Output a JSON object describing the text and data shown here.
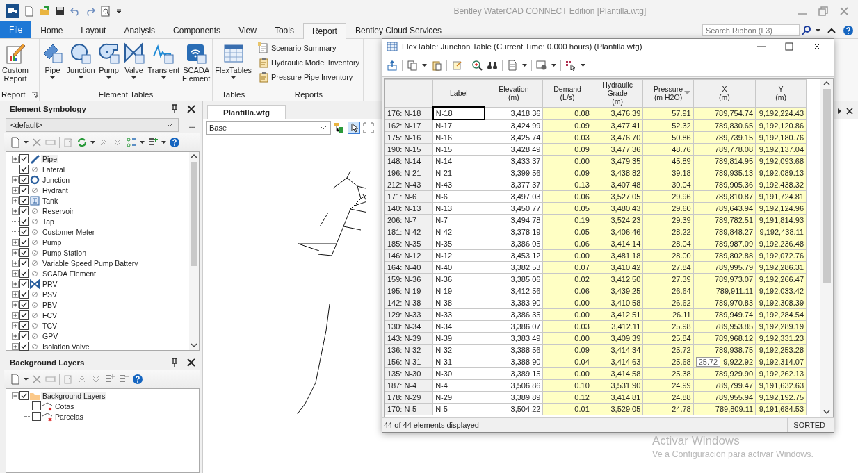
{
  "window": {
    "title": "Bentley WaterCAD CONNECT Edition [Plantilla.wtg]"
  },
  "ribbon": {
    "tabs": [
      {
        "label": "File",
        "kind": "file",
        "selected": false
      },
      {
        "label": "Home",
        "kind": "tab",
        "selected": false
      },
      {
        "label": "Layout",
        "kind": "tab",
        "selected": false
      },
      {
        "label": "Analysis",
        "kind": "tab",
        "selected": false
      },
      {
        "label": "Components",
        "kind": "tab",
        "selected": false
      },
      {
        "label": "View",
        "kind": "tab",
        "selected": false
      },
      {
        "label": "Tools",
        "kind": "tab",
        "selected": false
      },
      {
        "label": "Report",
        "kind": "tab",
        "selected": true
      },
      {
        "label": "Bentley Cloud Services",
        "kind": "tab",
        "selected": false
      }
    ],
    "search": {
      "placeholder": "Search Ribbon (F3)"
    },
    "groups": [
      {
        "label": "Report",
        "kind": "large",
        "launcher": true,
        "items": [
          {
            "label": "Custom\nReport",
            "kind": "report",
            "dropdown": false
          }
        ]
      },
      {
        "label": "Element Tables",
        "kind": "large",
        "launcher": false,
        "items": [
          {
            "label": "Pipe",
            "kind": "pipe",
            "dropdown": true
          },
          {
            "label": "Junction",
            "kind": "junction",
            "dropdown": true
          },
          {
            "label": "Pump",
            "kind": "pump",
            "dropdown": true
          },
          {
            "label": "Valve",
            "kind": "valve",
            "dropdown": true
          },
          {
            "label": "Transient",
            "kind": "transient",
            "dropdown": true
          },
          {
            "label": "SCADA\nElement",
            "kind": "scada",
            "dropdown": false
          }
        ]
      },
      {
        "label": "Tables",
        "kind": "large",
        "launcher": false,
        "items": [
          {
            "label": "FlexTables",
            "kind": "flextables",
            "dropdown": true
          }
        ]
      },
      {
        "label": "Reports",
        "kind": "list",
        "launcher": false,
        "items": [
          {
            "label": "Scenario Summary",
            "kind": "document"
          },
          {
            "label": "Hydraulic Model Inventory",
            "kind": "clipboard"
          },
          {
            "label": "Pressure Pipe Inventory",
            "kind": "clipboard"
          }
        ]
      }
    ]
  },
  "symbology": {
    "title": "Element Symbology",
    "profile": "<default>",
    "more": "...",
    "items": [
      {
        "label": "Pipe",
        "kind": "pipe",
        "checked": true,
        "expandable": true,
        "selected": true
      },
      {
        "label": "Lateral",
        "kind": "none",
        "checked": true,
        "expandable": false,
        "selected": false
      },
      {
        "label": "Junction",
        "kind": "junction",
        "checked": true,
        "expandable": true,
        "selected": false
      },
      {
        "label": "Hydrant",
        "kind": "none",
        "checked": true,
        "expandable": true,
        "selected": false
      },
      {
        "label": "Tank",
        "kind": "tank",
        "checked": true,
        "expandable": true,
        "selected": false
      },
      {
        "label": "Reservoir",
        "kind": "none",
        "checked": true,
        "expandable": true,
        "selected": false
      },
      {
        "label": "Tap",
        "kind": "none",
        "checked": true,
        "expandable": false,
        "selected": false
      },
      {
        "label": "Customer Meter",
        "kind": "none",
        "checked": true,
        "expandable": false,
        "selected": false
      },
      {
        "label": "Pump",
        "kind": "none",
        "checked": true,
        "expandable": true,
        "selected": false
      },
      {
        "label": "Pump Station",
        "kind": "none",
        "checked": true,
        "expandable": true,
        "selected": false
      },
      {
        "label": "Variable Speed Pump Battery",
        "kind": "none",
        "checked": true,
        "expandable": true,
        "selected": false
      },
      {
        "label": "SCADA Element",
        "kind": "none",
        "checked": true,
        "expandable": true,
        "selected": false
      },
      {
        "label": "PRV",
        "kind": "prv",
        "checked": true,
        "expandable": true,
        "selected": false
      },
      {
        "label": "PSV",
        "kind": "none",
        "checked": true,
        "expandable": true,
        "selected": false
      },
      {
        "label": "PBV",
        "kind": "none",
        "checked": true,
        "expandable": true,
        "selected": false
      },
      {
        "label": "FCV",
        "kind": "none",
        "checked": true,
        "expandable": true,
        "selected": false
      },
      {
        "label": "TCV",
        "kind": "none",
        "checked": true,
        "expandable": true,
        "selected": false
      },
      {
        "label": "GPV",
        "kind": "none",
        "checked": true,
        "expandable": true,
        "selected": false
      },
      {
        "label": "Isolation Valve",
        "kind": "none",
        "checked": true,
        "expandable": true,
        "selected": false
      }
    ]
  },
  "background_layers": {
    "title": "Background Layers",
    "items": [
      {
        "label": "Background Layers",
        "kind": "folder",
        "checked": true,
        "expanded": true,
        "selected": true,
        "children": [
          {
            "label": "Cotas",
            "kind": "layer",
            "checked": false,
            "selected": false
          },
          {
            "label": "Parcelas",
            "kind": "layer",
            "checked": false,
            "selected": false
          }
        ]
      }
    ]
  },
  "drawing": {
    "tab": "Plantilla.wtg",
    "scenario": "Base"
  },
  "flextable": {
    "title": "FlexTable: Junction Table (Current Time:  0.000 hours) (Plantilla.wtg)",
    "columns": [
      {
        "label": "Label",
        "read_only": false,
        "sorted": false
      },
      {
        "label": "Elevation\n(m)",
        "read_only": false,
        "sorted": false
      },
      {
        "label": "Demand\n(L/s)",
        "read_only": true,
        "sorted": false
      },
      {
        "label": "Hydraulic\nGrade\n(m)",
        "read_only": true,
        "sorted": false
      },
      {
        "label": "Pressure\n(m H2O)",
        "read_only": true,
        "sorted": true
      },
      {
        "label": "X\n(m)",
        "read_only": true,
        "sorted": false
      },
      {
        "label": "Y\n(m)",
        "read_only": true,
        "sorted": false
      }
    ],
    "rows": [
      {
        "id": "176: N-18",
        "focused": true,
        "cells": [
          "N-18",
          "3,418.36",
          "0.08",
          "3,476.39",
          "57.91",
          "789,754.74",
          "9,192,224.43"
        ]
      },
      {
        "id": "162: N-17",
        "focused": false,
        "cells": [
          "N-17",
          "3,424.99",
          "0.09",
          "3,477.41",
          "52.32",
          "789,830.65",
          "9,192,120.86"
        ]
      },
      {
        "id": "175: N-16",
        "focused": false,
        "cells": [
          "N-16",
          "3,425.74",
          "0.03",
          "3,476.70",
          "50.86",
          "789,739.15",
          "9,192,180.76"
        ]
      },
      {
        "id": "190: N-15",
        "focused": false,
        "cells": [
          "N-15",
          "3,428.49",
          "0.09",
          "3,477.36",
          "48.76",
          "789,778.08",
          "9,192,137.04"
        ]
      },
      {
        "id": "148: N-14",
        "focused": false,
        "cells": [
          "N-14",
          "3,433.37",
          "0.00",
          "3,479.35",
          "45.89",
          "789,814.95",
          "9,192,093.68"
        ]
      },
      {
        "id": "196: N-21",
        "focused": false,
        "cells": [
          "N-21",
          "3,399.56",
          "0.09",
          "3,438.82",
          "39.18",
          "789,935.13",
          "9,192,089.13"
        ]
      },
      {
        "id": "212: N-43",
        "focused": false,
        "cells": [
          "N-43",
          "3,377.37",
          "0.13",
          "3,407.48",
          "30.04",
          "789,905.36",
          "9,192,438.32"
        ]
      },
      {
        "id": "171: N-6",
        "focused": false,
        "cells": [
          "N-6",
          "3,497.03",
          "0.06",
          "3,527.05",
          "29.96",
          "789,810.87",
          "9,191,724.81"
        ]
      },
      {
        "id": "140: N-13",
        "focused": false,
        "cells": [
          "N-13",
          "3,450.77",
          "0.05",
          "3,480.43",
          "29.60",
          "789,643.94",
          "9,192,124.96"
        ]
      },
      {
        "id": "206: N-7",
        "focused": false,
        "cells": [
          "N-7",
          "3,494.78",
          "0.19",
          "3,524.23",
          "29.39",
          "789,782.51",
          "9,191,814.93"
        ]
      },
      {
        "id": "181: N-42",
        "focused": false,
        "cells": [
          "N-42",
          "3,378.19",
          "0.05",
          "3,406.46",
          "28.22",
          "789,848.27",
          "9,192,438.11"
        ]
      },
      {
        "id": "185: N-35",
        "focused": false,
        "cells": [
          "N-35",
          "3,386.05",
          "0.06",
          "3,414.14",
          "28.04",
          "789,987.09",
          "9,192,236.48"
        ]
      },
      {
        "id": "146: N-12",
        "focused": false,
        "cells": [
          "N-12",
          "3,453.12",
          "0.00",
          "3,481.18",
          "28.00",
          "789,802.88",
          "9,192,072.76"
        ]
      },
      {
        "id": "164: N-40",
        "focused": false,
        "cells": [
          "N-40",
          "3,382.53",
          "0.07",
          "3,410.42",
          "27.84",
          "789,995.79",
          "9,192,286.31"
        ]
      },
      {
        "id": "159: N-36",
        "focused": false,
        "cells": [
          "N-36",
          "3,385.06",
          "0.02",
          "3,412.50",
          "27.39",
          "789,973.07",
          "9,192,266.47"
        ]
      },
      {
        "id": "195: N-19",
        "focused": false,
        "cells": [
          "N-19",
          "3,412.56",
          "0.06",
          "3,439.25",
          "26.64",
          "789,911.11",
          "9,192,033.42"
        ]
      },
      {
        "id": "142: N-38",
        "focused": false,
        "cells": [
          "N-38",
          "3,383.90",
          "0.00",
          "3,410.58",
          "26.62",
          "789,970.83",
          "9,192,308.39"
        ]
      },
      {
        "id": "129: N-33",
        "focused": false,
        "cells": [
          "N-33",
          "3,386.35",
          "0.00",
          "3,412.51",
          "26.11",
          "789,949.74",
          "9,192,284.54"
        ]
      },
      {
        "id": "130: N-34",
        "focused": false,
        "cells": [
          "N-34",
          "3,386.07",
          "0.03",
          "3,412.11",
          "25.98",
          "789,953.85",
          "9,192,289.19"
        ]
      },
      {
        "id": "143: N-39",
        "focused": false,
        "cells": [
          "N-39",
          "3,383.49",
          "0.00",
          "3,409.39",
          "25.84",
          "789,968.12",
          "9,192,331.23"
        ]
      },
      {
        "id": "136: N-32",
        "focused": false,
        "cells": [
          "N-32",
          "3,388.56",
          "0.09",
          "3,414.34",
          "25.72",
          "789,938.75",
          "9,192,253.28"
        ]
      },
      {
        "id": "156: N-31",
        "focused": false,
        "tooltip": "25.72",
        "cells": [
          "N-31",
          "3,388.90",
          "0.04",
          "3,414.63",
          "25.68",
          "9,922.92",
          "9,192,314.07"
        ]
      },
      {
        "id": "135: N-30",
        "focused": false,
        "cells": [
          "N-30",
          "3,389.15",
          "0.00",
          "3,414.58",
          "25.38",
          "789,929.90",
          "9,192,262.13"
        ]
      },
      {
        "id": "187: N-4",
        "focused": false,
        "cells": [
          "N-4",
          "3,506.86",
          "0.10",
          "3,531.90",
          "24.99",
          "789,799.47",
          "9,191,632.63"
        ]
      },
      {
        "id": "178: N-29",
        "focused": false,
        "cells": [
          "N-29",
          "3,389.89",
          "0.12",
          "3,414.81",
          "24.88",
          "789,955.94",
          "9,192,192.75"
        ]
      },
      {
        "id": "170: N-5",
        "focused": false,
        "cells": [
          "N-5",
          "3,504.22",
          "0.01",
          "3,529.05",
          "24.78",
          "789,809.11",
          "9,191,684.53"
        ]
      }
    ],
    "status": "44 of 44 elements displayed",
    "sort_status": "SORTED"
  },
  "activation_notice": {
    "title": "Activar Windows",
    "text": "Ve a Configuración para activar Windows."
  }
}
